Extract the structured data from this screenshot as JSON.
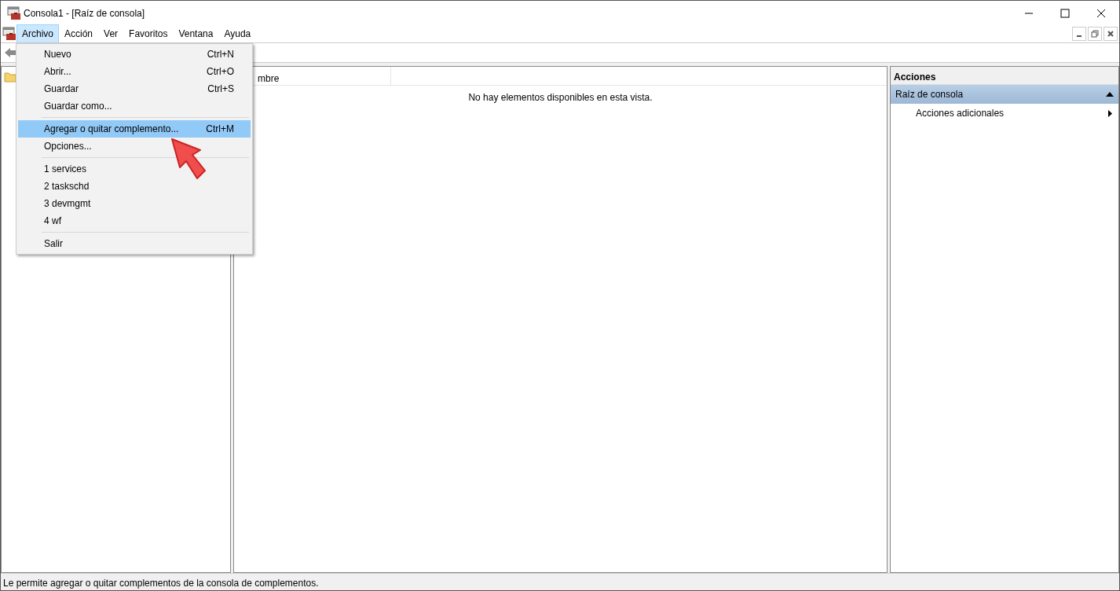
{
  "window": {
    "title": "Consola1 - [Raíz de consola]"
  },
  "menubar": [
    {
      "label": "Archivo",
      "selected": true
    },
    {
      "label": "Acción",
      "selected": false
    },
    {
      "label": "Ver",
      "selected": false
    },
    {
      "label": "Favoritos",
      "selected": false
    },
    {
      "label": "Ventana",
      "selected": false
    },
    {
      "label": "Ayuda",
      "selected": false
    }
  ],
  "file_menu": [
    {
      "kind": "item",
      "label": "Nuevo",
      "shortcut": "Ctrl+N",
      "selected": false
    },
    {
      "kind": "item",
      "label": "Abrir...",
      "shortcut": "Ctrl+O",
      "selected": false
    },
    {
      "kind": "item",
      "label": "Guardar",
      "shortcut": "Ctrl+S",
      "selected": false
    },
    {
      "kind": "item",
      "label": "Guardar como...",
      "selected": false
    },
    {
      "kind": "separator"
    },
    {
      "kind": "item",
      "label": "Agregar o quitar complemento...",
      "shortcut": "Ctrl+M",
      "selected": true
    },
    {
      "kind": "item",
      "label": "Opciones...",
      "selected": false
    },
    {
      "kind": "separator"
    },
    {
      "kind": "item",
      "label": "1 services",
      "selected": false
    },
    {
      "kind": "item",
      "label": "2 taskschd",
      "selected": false
    },
    {
      "kind": "item",
      "label": "3 devmgmt",
      "selected": false
    },
    {
      "kind": "item",
      "label": "4 wf",
      "selected": false
    },
    {
      "kind": "separator"
    },
    {
      "kind": "item",
      "label": "Salir",
      "selected": false
    }
  ],
  "list": {
    "column_1": "mbre",
    "empty_message": "No hay elementos disponibles en esta vista."
  },
  "actions": {
    "title": "Acciones",
    "section": {
      "label": "Raíz de consola",
      "expanded": true
    },
    "items": [
      {
        "label": "Acciones adicionales"
      }
    ]
  },
  "status_bar": "Le permite agregar o quitar complementos de la consola de complementos."
}
